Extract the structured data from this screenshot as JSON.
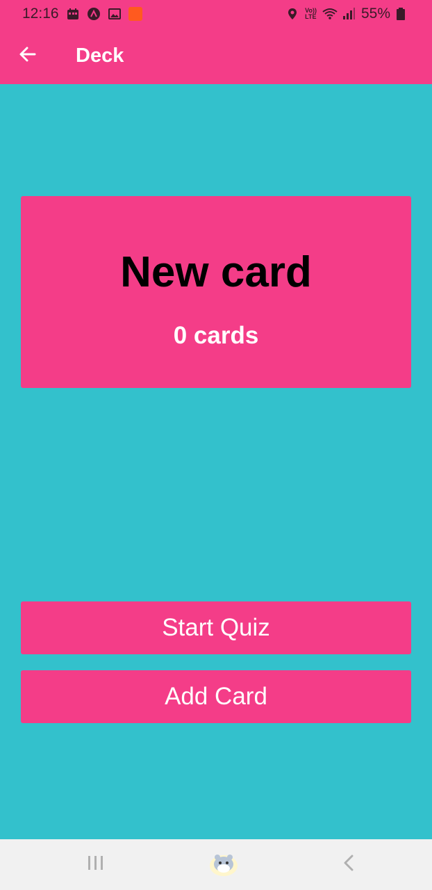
{
  "status_bar": {
    "time": "12:16",
    "battery": "55%",
    "network": "LTE",
    "volte": "Vo))"
  },
  "app_bar": {
    "title": "Deck",
    "back_icon": "arrow-left-icon"
  },
  "deck": {
    "title": "New card",
    "count_text": "0 cards"
  },
  "actions": {
    "start_quiz": "Start Quiz",
    "add_card": "Add Card"
  },
  "nav": {
    "recents_icon": "recents-icon",
    "home_icon": "home-icon",
    "back_icon": "chevron-left-icon"
  },
  "colors": {
    "accent": "#f43d88",
    "background": "#33c1cc",
    "nav_bar": "#f1f1f1"
  }
}
